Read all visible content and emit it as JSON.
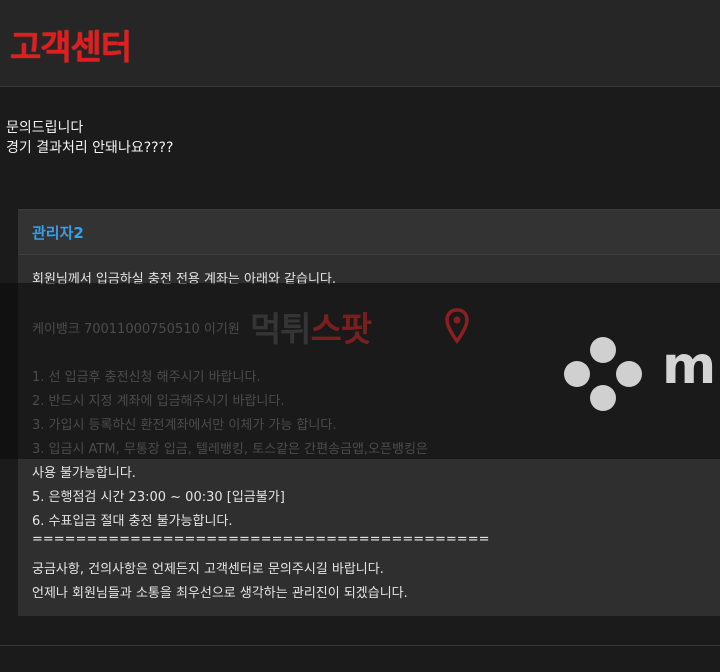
{
  "header": {
    "title": "고객센터"
  },
  "question": {
    "lines": [
      "문의드립니다",
      "경기 결과처리 안돼나요????"
    ]
  },
  "reply": {
    "author": "관리자2",
    "lines": [
      "회원님께서 입금하실 충전 전용 계좌는 아래와 같습니다.",
      "케이뱅크 70011000750510 이기원",
      "1. 선 입금후 충전신청 해주시기 바랍니다.",
      "2. 반드시 지정 계좌에 입금해주시기 바랍니다.",
      "3. 가입시 등록하신 환전계좌에서만 이체가 가능 합니다.",
      "3. 입금시 ATM, 무통장 입금, 텔레뱅킹, 토스같은 간편송금앱,오픈뱅킹은",
      "사용 불가능합니다.",
      "5. 은행점검 시간 23:00 ~ 00:30 [입금불가]",
      "6. 수표입금 절대 충전 불가능합니다.",
      "==========================================",
      "궁금사항, 건의사항은 언제든지 고객센터로 문의주시길 바랍니다.",
      "언제나 회원님들과 소통을 최우선으로 생각하는 관리진이 되겠습니다."
    ]
  },
  "watermark": {
    "part1": "먹튀",
    "part2": "스팟",
    "logo": "m"
  },
  "colors": {
    "title": "#e11d1d",
    "author": "#3aa0e6",
    "background": "#1b1b1b",
    "panel": "#2f2f2f"
  }
}
